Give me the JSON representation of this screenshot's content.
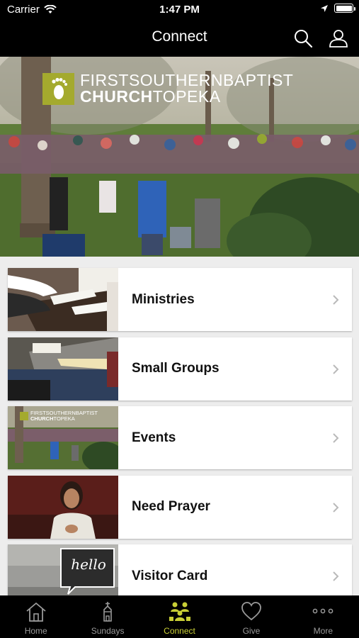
{
  "status_bar": {
    "carrier": "Carrier",
    "time": "1:47 PM"
  },
  "nav": {
    "title": "Connect"
  },
  "hero": {
    "logo_line1": "FIRSTSOUTHERNBAPTIST",
    "logo_line2_bold": "CHURCH",
    "logo_line2_rest": "TOPEKA"
  },
  "items": [
    {
      "label": "Ministries"
    },
    {
      "label": "Small Groups"
    },
    {
      "label": "Events"
    },
    {
      "label": "Need Prayer"
    },
    {
      "label": "Visitor Card"
    }
  ],
  "thumb_texts": {
    "events_line1": "FIRSTSOUTHERNBAPTIST",
    "events_line2_bold": "CHURCH",
    "events_line2_rest": "TOPEKA",
    "visitor_hello": "hello"
  },
  "tabs": [
    {
      "label": "Home"
    },
    {
      "label": "Sundays"
    },
    {
      "label": "Connect"
    },
    {
      "label": "Give"
    },
    {
      "label": "More"
    }
  ],
  "colors": {
    "accent": "#c9cf36",
    "logo_green": "#a4aa2e",
    "bar": "#000000",
    "background": "#ededed"
  }
}
